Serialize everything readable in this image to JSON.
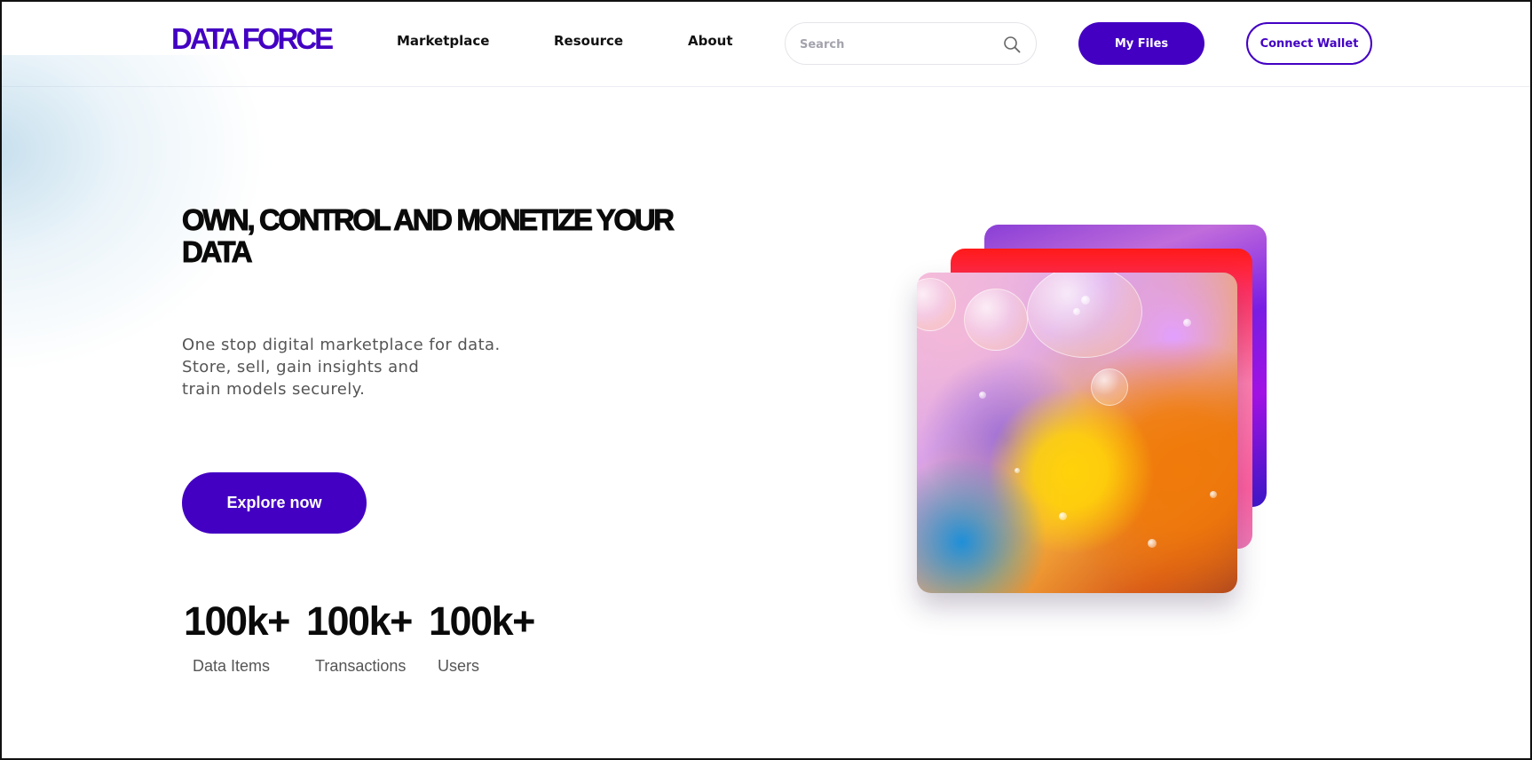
{
  "header": {
    "logo_text": "DATA FORCE",
    "logo_color": "#4300c3",
    "nav": [
      "Marketplace",
      "Resource",
      "About"
    ],
    "search": {
      "placeholder": "Search",
      "icon": "search-icon"
    },
    "my_files_label": "My Files",
    "connect_wallet_label": "Connect Wallet"
  },
  "hero": {
    "title": "OWN, CONTROL AND MONETIZE YOUR DATA",
    "subtitle": "One stop digital marketplace for data.\nStore, sell, gain insights and\ntrain models securely.",
    "cta_label": "Explore now"
  },
  "stats": [
    {
      "value": "100k+",
      "label": "Data Items"
    },
    {
      "value": "100k+",
      "label": "Transactions"
    },
    {
      "value": "100k+",
      "label": "Users"
    }
  ],
  "colors": {
    "accent": "#4300c3",
    "text_dark": "#0a0a0a",
    "text_muted": "#555555"
  }
}
